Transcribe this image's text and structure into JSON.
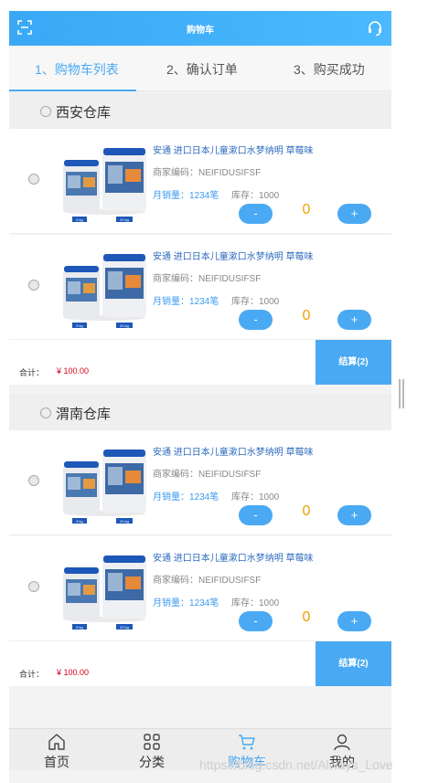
{
  "header": {
    "title": "购物车",
    "left_icon": "scan-icon",
    "right_icon": "headset-icon"
  },
  "tabs": [
    {
      "label": "1、购物车列表",
      "active": true
    },
    {
      "label": "2、确认订单",
      "active": false
    },
    {
      "label": "3、购买成功",
      "active": false
    }
  ],
  "warehouses": [
    {
      "name": "西安仓库",
      "items": [
        {
          "name": "安通 进口日本儿童漱口水梦纳明 草莓味",
          "merchant": "商家编码：NEIFIDUSIFSF",
          "sales": "月销量：1234笔",
          "stock": "库存：1000",
          "qty": "0",
          "minus": "-",
          "plus": "+",
          "labels": [
            "5 kg",
            "20 kg"
          ]
        },
        {
          "name": "安通 进口日本儿童漱口水梦纳明 草莓味",
          "merchant": "商家编码：NEIFIDUSIFSF",
          "sales": "月销量：1234笔",
          "stock": "库存：1000",
          "qty": "0",
          "minus": "-",
          "plus": "+",
          "labels": [
            "5 kg",
            "20 kg"
          ]
        }
      ],
      "total_label": "合计：",
      "total": "¥ 100.00",
      "settle": "结算(2)"
    },
    {
      "name": "渭南仓库",
      "items": [
        {
          "name": "安通 进口日本儿童漱口水梦纳明 草莓味",
          "merchant": "商家编码：NEIFIDUSIFSF",
          "sales": "月销量：1234笔",
          "stock": "库存：1000",
          "qty": "0",
          "minus": "-",
          "plus": "+",
          "labels": [
            "5 kg",
            "20 kg"
          ]
        },
        {
          "name": "安通 进口日本儿童漱口水梦纳明 草莓味",
          "merchant": "商家编码：NEIFIDUSIFSF",
          "sales": "月销量：1234笔",
          "stock": "库存：1000",
          "qty": "0",
          "minus": "-",
          "plus": "+",
          "labels": [
            "5 kg",
            "20 kg"
          ]
        }
      ],
      "total_label": "合计：",
      "total": "¥ 100.00",
      "settle": "结算(2)"
    }
  ],
  "tabbar": [
    {
      "label": "首页",
      "icon": "home-icon",
      "active": false
    },
    {
      "label": "分类",
      "icon": "grid-icon",
      "active": false
    },
    {
      "label": "购物车",
      "icon": "cart-icon",
      "active": true
    },
    {
      "label": "我的",
      "icon": "user-icon",
      "active": false
    }
  ],
  "watermark": "https://blog.csdn.net/Always_Love",
  "colors": {
    "accent": "#4aa9f3",
    "price": "#d0021b",
    "qty": "#f0a000"
  }
}
